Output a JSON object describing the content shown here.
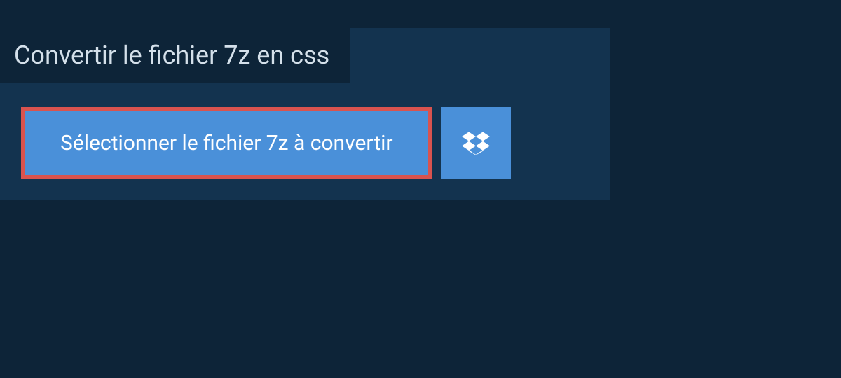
{
  "title": "Convertir le fichier 7z en css",
  "buttons": {
    "select_file_label": "Sélectionner le fichier 7z à convertir"
  },
  "colors": {
    "background": "#0d2438",
    "panel": "#13334f",
    "button": "#4a90d9",
    "highlight_border": "#d9534f",
    "text_light": "#d4e0ea",
    "text_white": "#ffffff"
  }
}
